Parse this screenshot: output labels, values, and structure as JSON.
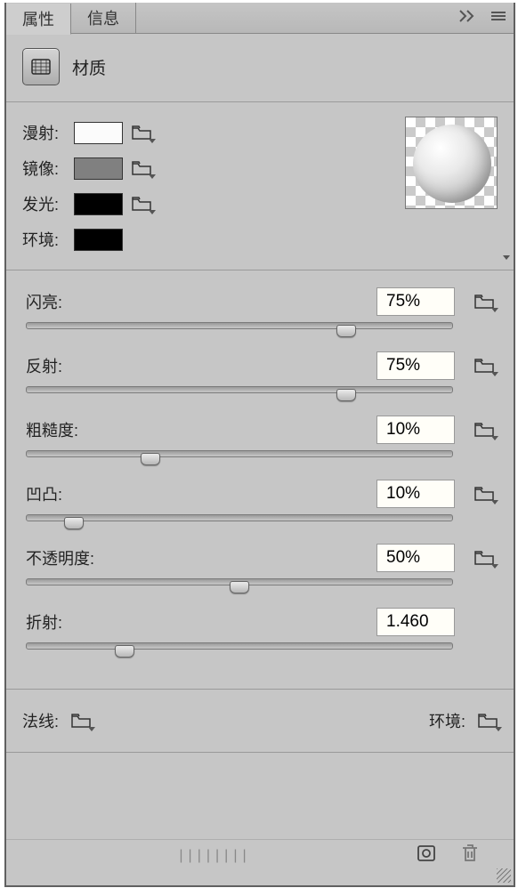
{
  "tabs": {
    "properties": "属性",
    "info": "信息"
  },
  "header": {
    "title": "材质"
  },
  "colors": {
    "diffuse": {
      "label": "漫射:",
      "hex": "#fbfbfb",
      "hasFolder": true
    },
    "specular": {
      "label": "镜像:",
      "hex": "#808080",
      "hasFolder": true
    },
    "emission": {
      "label": "发光:",
      "hex": "#000000",
      "hasFolder": true
    },
    "ambient": {
      "label": "环境:",
      "hex": "#000000",
      "hasFolder": false
    }
  },
  "sliders": {
    "shine": {
      "label": "闪亮:",
      "value": "75%",
      "pos": 75,
      "hasFolder": true
    },
    "reflect": {
      "label": "反射:",
      "value": "75%",
      "pos": 75,
      "hasFolder": true
    },
    "roughness": {
      "label": "粗糙度:",
      "value": "10%",
      "pos": 29,
      "hasFolder": true
    },
    "bump": {
      "label": "凹凸:",
      "value": "10%",
      "pos": 11,
      "hasFolder": true
    },
    "opacity": {
      "label": "不透明度:",
      "value": "50%",
      "pos": 50,
      "hasFolder": true
    },
    "refraction": {
      "label": "折射:",
      "value": "1.460",
      "pos": 23,
      "hasFolder": false
    }
  },
  "bottom": {
    "normal": "法线:",
    "environment": "环境:"
  },
  "icons": {
    "render": "render-icon",
    "trash": "trash-icon"
  }
}
